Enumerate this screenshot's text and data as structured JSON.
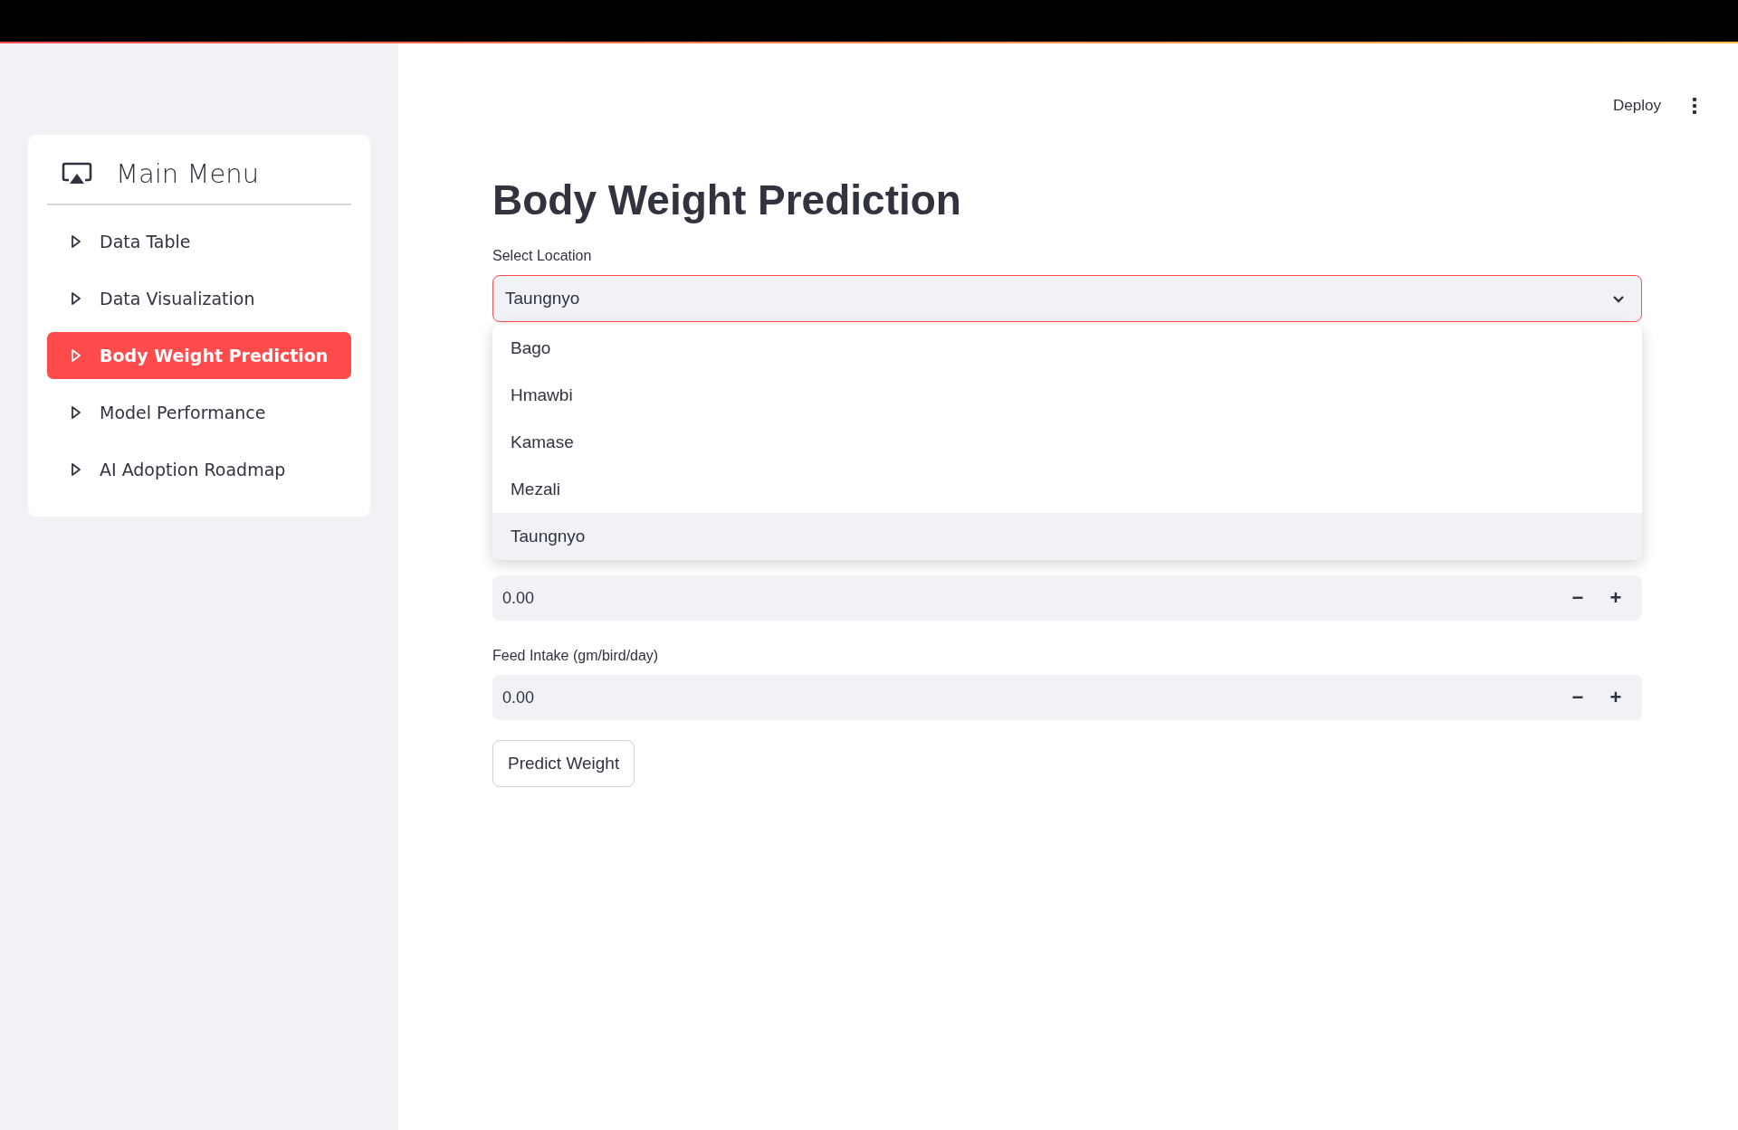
{
  "header": {
    "deploy": "Deploy"
  },
  "menu": {
    "title": "Main Menu",
    "items": [
      {
        "label": "Data Table",
        "selected": false
      },
      {
        "label": "Data Visualization",
        "selected": false
      },
      {
        "label": "Body Weight Prediction",
        "selected": true
      },
      {
        "label": "Model Performance",
        "selected": false
      },
      {
        "label": "AI Adoption Roadmap",
        "selected": false
      }
    ]
  },
  "page": {
    "title": "Body Weight Prediction",
    "select": {
      "label": "Select Location",
      "value": "Taungnyo",
      "open": true,
      "options": [
        {
          "label": "Bago",
          "selected": false
        },
        {
          "label": "Hmawbi",
          "selected": false
        },
        {
          "label": "Kamase",
          "selected": false
        },
        {
          "label": "Mezali",
          "selected": false
        },
        {
          "label": "Taungnyo",
          "selected": true
        }
      ]
    },
    "number_inputs": [
      {
        "value": "0.00",
        "decrement": "−",
        "increment": "+"
      },
      {
        "label": "Feed Intake (gm/bird/day)",
        "value": "0.00",
        "decrement": "−",
        "increment": "+"
      }
    ],
    "button": "Predict Weight"
  }
}
